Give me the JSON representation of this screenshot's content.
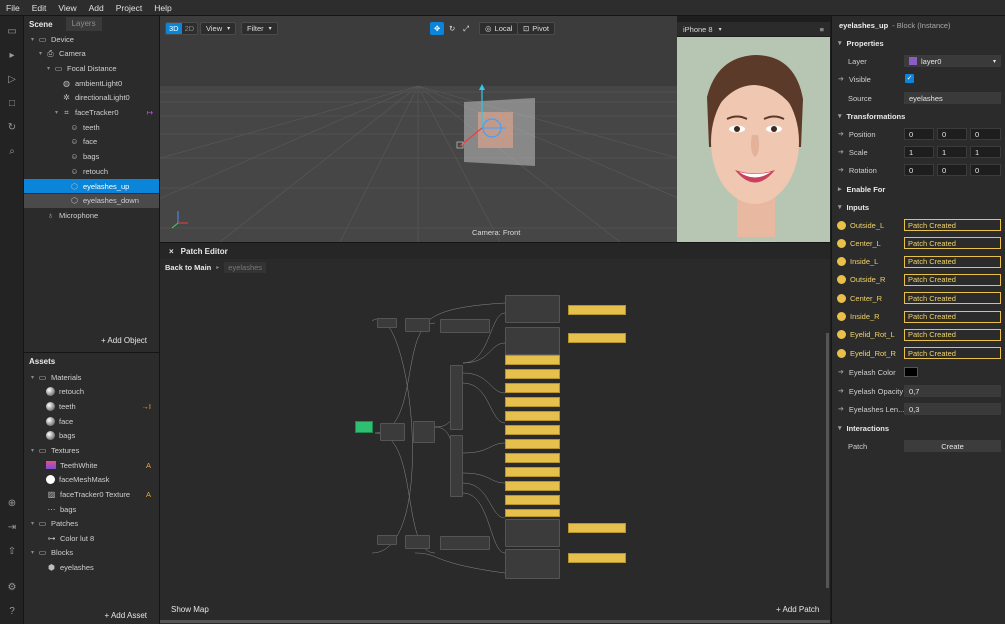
{
  "menu": [
    "File",
    "Edit",
    "View",
    "Add",
    "Project",
    "Help"
  ],
  "scene": {
    "title": "Scene",
    "tab": "Layers",
    "items": [
      {
        "label": "Device",
        "icon": "device-icon",
        "level": 0,
        "arrow": "▾"
      },
      {
        "label": "Camera",
        "icon": "camera-icon",
        "level": 1,
        "arrow": "▾"
      },
      {
        "label": "Focal Distance",
        "icon": "folder-icon",
        "level": 2,
        "arrow": "▾"
      },
      {
        "label": "ambientLight0",
        "icon": "ambient-light-icon",
        "level": 3,
        "arrow": ""
      },
      {
        "label": "directionalLight0",
        "icon": "directional-light-icon",
        "level": 3,
        "arrow": ""
      },
      {
        "label": "faceTracker0",
        "icon": "face-tracker-icon",
        "level": 3,
        "arrow": "▾"
      },
      {
        "label": "teeth",
        "icon": "face-mesh-icon",
        "level": 4,
        "arrow": ""
      },
      {
        "label": "face",
        "icon": "face-mesh-icon",
        "level": 4,
        "arrow": ""
      },
      {
        "label": "bags",
        "icon": "face-mesh-icon",
        "level": 4,
        "arrow": ""
      },
      {
        "label": "retouch",
        "icon": "face-mesh-icon",
        "level": 4,
        "arrow": ""
      },
      {
        "label": "eyelashes_up",
        "icon": "block-icon",
        "level": 4,
        "arrow": ""
      },
      {
        "label": "eyelashes_down",
        "icon": "block-icon",
        "level": 4,
        "arrow": ""
      },
      {
        "label": "Microphone",
        "icon": "microphone-icon",
        "level": 1,
        "arrow": ""
      }
    ],
    "add_object": "+ Add Object"
  },
  "assets": {
    "title": "Assets",
    "groups": [
      {
        "label": "Materials",
        "children": [
          "retouch",
          "teeth",
          "face",
          "bags"
        ]
      },
      {
        "label": "Textures",
        "children": [
          "TeethWhite",
          "faceMeshMask",
          "faceTracker0 Texture",
          "bags"
        ]
      },
      {
        "label": "Patches",
        "children": [
          "Color lut 8"
        ]
      },
      {
        "label": "Blocks",
        "children": [
          "eyelashes"
        ]
      }
    ],
    "badge_teeth": "→I",
    "badge_a": "A",
    "add_asset": "+ Add Asset"
  },
  "viewport": {
    "btn_3d": "3D",
    "btn_2d": "2D",
    "view": "View",
    "filter": "Filter",
    "local": "Local",
    "pivot": "Pivot",
    "camera_label": "Camera: Front"
  },
  "phone": {
    "device": "iPhone 8"
  },
  "patch": {
    "title": "Patch Editor",
    "back": "Back to Main",
    "crumb": "eyelashes",
    "show_map": "Show Map",
    "add_patch": "+ Add Patch"
  },
  "props": {
    "title": "eyelashes_up",
    "subtitle": "- Block (Instance)",
    "properties": "Properties",
    "layer_label": "Layer",
    "layer_value": "layer0",
    "visible_label": "Visible",
    "source_label": "Source",
    "source_value": "eyelashes",
    "transformations": "Transformations",
    "position": "Position",
    "scale": "Scale",
    "rotation": "Rotation",
    "pos_vals": [
      "0",
      "0",
      "0"
    ],
    "scale_vals": [
      "1",
      "1",
      "1"
    ],
    "rot_vals": [
      "0",
      "0",
      "0"
    ],
    "enable_for": "Enable For",
    "inputs": "Inputs",
    "patch_inputs": [
      {
        "label": "Outside_L",
        "value": "Patch Created"
      },
      {
        "label": "Center_L",
        "value": "Patch Created"
      },
      {
        "label": "Inside_L",
        "value": "Patch Created"
      },
      {
        "label": "Outside_R",
        "value": "Patch Created"
      },
      {
        "label": "Center_R",
        "value": "Patch Created"
      },
      {
        "label": "Inside_R",
        "value": "Patch Created"
      },
      {
        "label": "Eyelid_Rot_L",
        "value": "Patch Created"
      },
      {
        "label": "Eyelid_Rot_R",
        "value": "Patch Created"
      }
    ],
    "eyelash_color": "Eyelash Color",
    "eyelash_opacity": "Eyelash Opacity",
    "opacity_value": "0,7",
    "eyelash_length": "Eyelashes Len...",
    "length_value": "0,3",
    "interactions": "Interactions",
    "patch_label": "Patch",
    "create": "Create"
  },
  "colors": {
    "accent": "#0a85d9",
    "patch_yellow": "#e9c14a",
    "green_node": "#2fbf71"
  }
}
